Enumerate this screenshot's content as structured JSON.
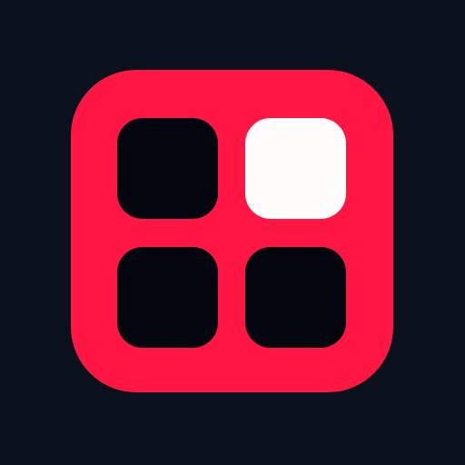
{
  "logo": {
    "name": "grid-app-icon",
    "background_color": "#0b111c",
    "accent_color": "#ff1744",
    "tiles": [
      {
        "name": "tile-top-left",
        "color": "#03060f"
      },
      {
        "name": "tile-top-right",
        "color": "#fffcfc"
      },
      {
        "name": "tile-bottom-left",
        "color": "#03060f"
      },
      {
        "name": "tile-bottom-right",
        "color": "#03060f"
      }
    ]
  }
}
